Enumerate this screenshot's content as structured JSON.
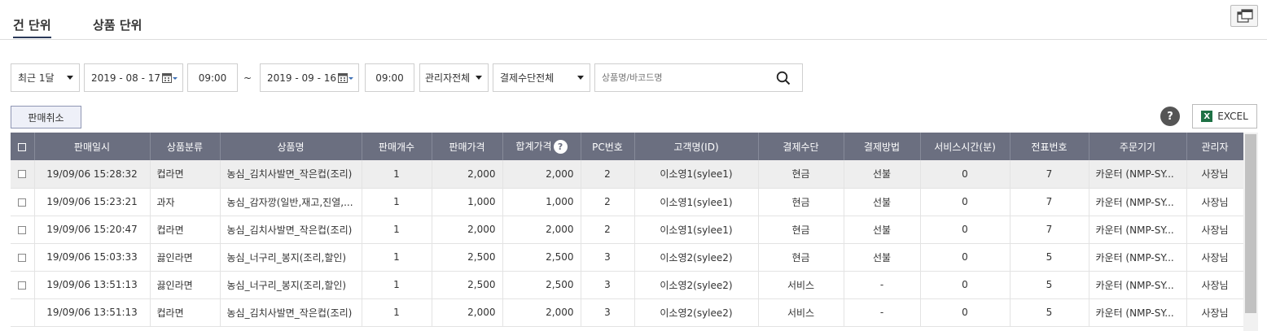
{
  "tabs": [
    {
      "label": "건 단위",
      "active": true
    },
    {
      "label": "상품 단위",
      "active": false
    }
  ],
  "filters": {
    "period": "최근 1달",
    "start_date": "2019 - 08 - 17",
    "start_time": "09:00",
    "separator": "~",
    "end_date": "2019 - 09 - 16",
    "end_time": "09:00",
    "manager": "관리자전체",
    "payment_method": "결제수단전체",
    "search_placeholder": "상품명/바코드명"
  },
  "actions": {
    "cancel_label": "판매취소",
    "help_label": "?",
    "excel_label": "EXCEL",
    "excel_icon_letter": "X"
  },
  "table": {
    "headers": [
      "판매일시",
      "상품분류",
      "상품명",
      "판매개수",
      "판매가격",
      "합계가격",
      "PC번호",
      "고객명(ID)",
      "결제수단",
      "결제방법",
      "서비스시간(분)",
      "전표번호",
      "주문기기",
      "관리자"
    ],
    "header_help": "?",
    "rows": [
      {
        "has_checkbox": true,
        "date": "19/09/06 15:28:32",
        "category": "컵라면",
        "product": "농심_김치사발면_작은컵(조리)",
        "qty": "1",
        "price": "2,000",
        "total": "2,000",
        "pc": "2",
        "customer": "이소영1(sylee1)",
        "pay_means": "현금",
        "pay_method": "선불",
        "service_min": "0",
        "slip": "7",
        "device": "카운터 (NMP-SY...",
        "manager": "사장님"
      },
      {
        "has_checkbox": true,
        "date": "19/09/06 15:23:21",
        "category": "과자",
        "product": "농심_감자깡(일반,재고,진열,...",
        "qty": "1",
        "price": "1,000",
        "total": "1,000",
        "pc": "2",
        "customer": "이소영1(sylee1)",
        "pay_means": "현금",
        "pay_method": "선불",
        "service_min": "0",
        "slip": "7",
        "device": "카운터 (NMP-SY...",
        "manager": "사장님"
      },
      {
        "has_checkbox": true,
        "date": "19/09/06 15:20:47",
        "category": "컵라면",
        "product": "농심_김치사발면_작은컵(조리)",
        "qty": "1",
        "price": "2,000",
        "total": "2,000",
        "pc": "2",
        "customer": "이소영1(sylee1)",
        "pay_means": "현금",
        "pay_method": "선불",
        "service_min": "0",
        "slip": "7",
        "device": "카운터 (NMP-SY...",
        "manager": "사장님"
      },
      {
        "has_checkbox": true,
        "date": "19/09/06 15:03:33",
        "category": "끓인라면",
        "product": "농심_너구리_봉지(조리,할인)",
        "qty": "1",
        "price": "2,500",
        "total": "2,500",
        "pc": "3",
        "customer": "이소영2(sylee2)",
        "pay_means": "현금",
        "pay_method": "선불",
        "service_min": "0",
        "slip": "5",
        "device": "카운터 (NMP-SY...",
        "manager": "사장님"
      },
      {
        "has_checkbox": true,
        "date": "19/09/06 13:51:13",
        "category": "끓인라면",
        "product": "농심_너구리_봉지(조리,할인)",
        "qty": "1",
        "price": "2,500",
        "total": "2,500",
        "pc": "3",
        "customer": "이소영2(sylee2)",
        "pay_means": "서비스",
        "pay_method": "-",
        "service_min": "0",
        "slip": "5",
        "device": "카운터 (NMP-SY...",
        "manager": "사장님"
      },
      {
        "has_checkbox": false,
        "date": "19/09/06 13:51:13",
        "category": "컵라면",
        "product": "농심_김치사발면_작은컵(조리)",
        "qty": "1",
        "price": "2,000",
        "total": "2,000",
        "pc": "3",
        "customer": "이소영2(sylee2)",
        "pay_means": "서비스",
        "pay_method": "-",
        "service_min": "0",
        "slip": "5",
        "device": "카운터 (NMP-SY...",
        "manager": "사장님"
      }
    ]
  }
}
